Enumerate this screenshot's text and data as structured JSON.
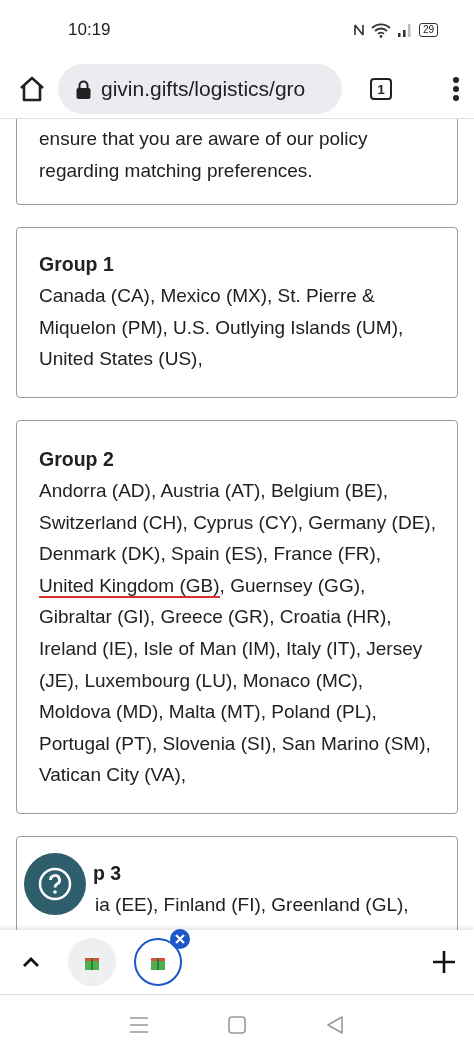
{
  "status_bar": {
    "time": "10:19",
    "battery": "29"
  },
  "address_bar": {
    "url": "givin.gifts/logistics/gro",
    "tab_count": "1"
  },
  "intro": {
    "text": "ensure that you are aware of our policy regarding matching preferences."
  },
  "groups": [
    {
      "title": "Group 1",
      "segments": [
        {
          "text": "Canada (CA), Mexico (MX), St. Pierre & Miquelon (PM), U.S. Outlying Islands (UM), United States (US),",
          "underlined": false
        }
      ]
    },
    {
      "title": "Group 2",
      "segments": [
        {
          "text": "Andorra (AD), Austria (AT), Belgium (BE), Switzerland (CH), Cyprus (CY), Germany (DE), Denmark (DK), Spain (ES), France (FR),",
          "underlined": false
        },
        {
          "text": "United Kingdom (GB)",
          "underlined": true
        },
        {
          "text": ", Guernsey (GG), Gibraltar (GI), Greece (GR), Croatia (HR), Ireland (IE), Isle of Man (IM), Italy (IT), Jersey (JE), Luxembourg (LU), Monaco (MC), Moldova (MD), Malta (MT), Poland (PL), Portugal (PT), Slovenia (SI), San Marino (SM), Vatican City (VA),",
          "underlined": false
        }
      ]
    },
    {
      "title": "p 3",
      "segments": [
        {
          "text": "ia (EE), Finland (FI), Greenland (GL),",
          "underlined": false
        }
      ]
    }
  ],
  "tab_strip": {
    "tabs": [
      {
        "selected": false
      },
      {
        "selected": true
      }
    ]
  }
}
